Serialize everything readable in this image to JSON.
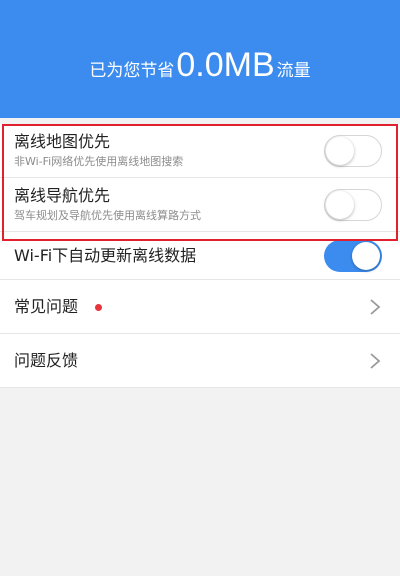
{
  "header": {
    "saved_prefix": "已为您节省",
    "saved_value": "0.0MB",
    "saved_suffix": "流量",
    "bg_color": "#3c8cf0"
  },
  "settings": {
    "offline_map": {
      "title": "离线地图优先",
      "subtitle": "非Wi-Fi网络优先使用离线地图搜索",
      "toggle": "off"
    },
    "offline_nav": {
      "title": "离线导航优先",
      "subtitle": "驾车规划及导航优先使用离线算路方式",
      "toggle": "off"
    },
    "wifi_update": {
      "title": "Wi-Fi下自动更新离线数据",
      "toggle": "on"
    },
    "faq": {
      "title": "常见问题",
      "badge_color": "#e8343c"
    },
    "feedback": {
      "title": "问题反馈"
    }
  },
  "accent_color": "#3c8cf0",
  "highlight_color": "#e0202e"
}
